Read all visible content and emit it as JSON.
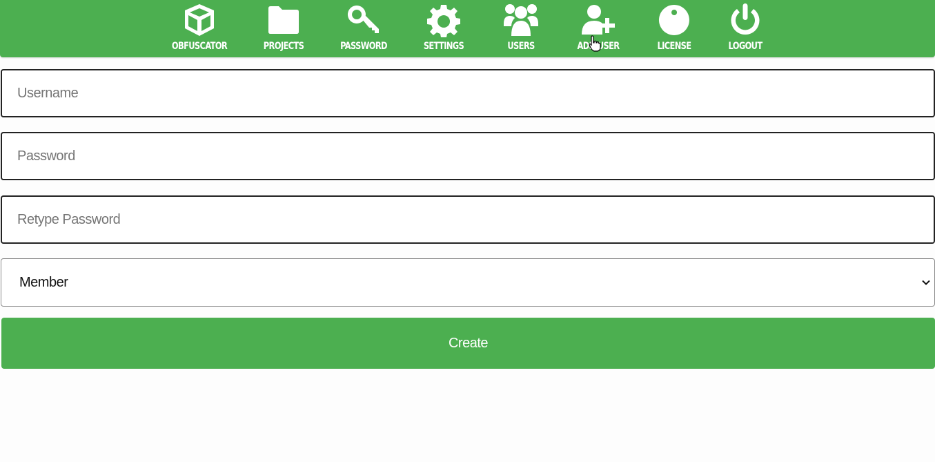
{
  "nav": {
    "items": [
      {
        "label": "OBFUSCATOR",
        "icon": "cube-icon"
      },
      {
        "label": "PROJECTS",
        "icon": "folder-icon"
      },
      {
        "label": "PASSWORD",
        "icon": "key-icon"
      },
      {
        "label": "SETTINGS",
        "icon": "gear-icon"
      },
      {
        "label": "USERS",
        "icon": "users-icon"
      },
      {
        "label": "ADD USER",
        "icon": "user-plus-icon"
      },
      {
        "label": "LICENSE",
        "icon": "info-icon"
      },
      {
        "label": "LOGOUT",
        "icon": "power-icon"
      }
    ]
  },
  "form": {
    "username_placeholder": "Username",
    "password_placeholder": "Password",
    "retype_password_placeholder": "Retype Password",
    "role_selected": "Member",
    "create_label": "Create"
  },
  "colors": {
    "accent": "#4caf50",
    "text_on_accent": "#ffffff",
    "placeholder": "#757575"
  }
}
